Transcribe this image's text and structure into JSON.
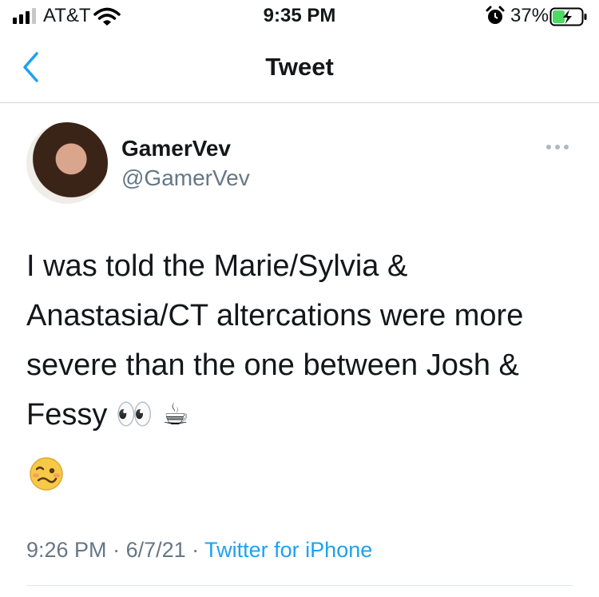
{
  "status_bar": {
    "carrier": "AT&T",
    "time": "9:35 PM",
    "battery_percent": "37%",
    "icons": [
      "signal-icon",
      "wifi-icon",
      "alarm-icon",
      "battery-charging-icon"
    ]
  },
  "nav": {
    "title": "Tweet",
    "back_icon": "chevron-left-icon"
  },
  "tweet": {
    "display_name": "GamerVev",
    "handle": "@GamerVev",
    "text": "I was told the Marie/Sylvia &\nAnastasia/CT altercations were more\nsevere than the one between Josh &\nFessy 👀 ☕",
    "trailing_emoji": "🥴",
    "time": "9:26 PM",
    "date": "6/7/21",
    "separator": " · ",
    "source": "Twitter for iPhone"
  },
  "colors": {
    "text": "#14171a",
    "secondary": "#657786",
    "accent": "#1da1f2",
    "divider": "#d3d6da"
  }
}
